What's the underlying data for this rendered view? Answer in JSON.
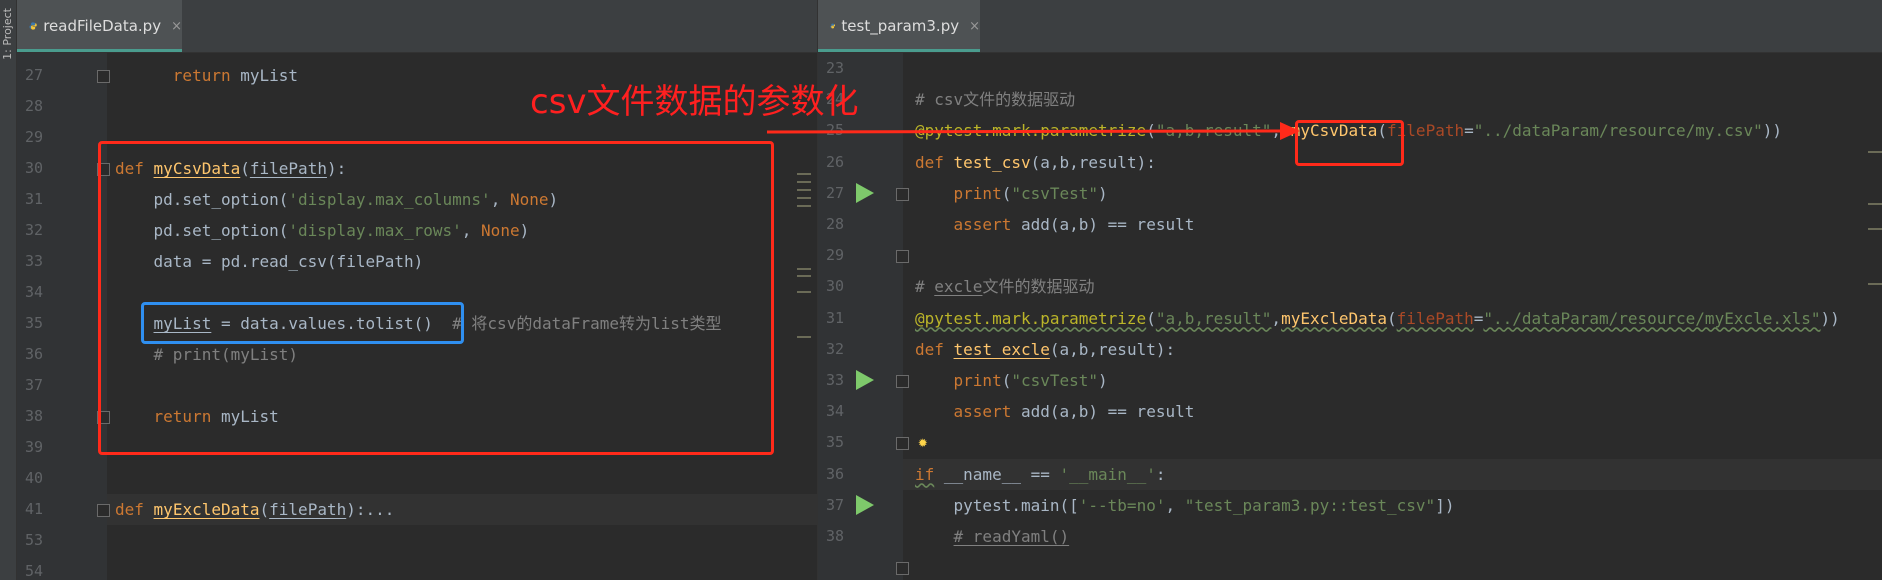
{
  "side_panel": {
    "label": "1: Project"
  },
  "left_editor": {
    "tab": {
      "file_name": "readFileData.py",
      "close": "×"
    },
    "lines": [
      {
        "n": "27",
        "parts": [
          [
            "      ",
            ""
          ],
          [
            "return",
            "kw"
          ],
          [
            " myList",
            ""
          ]
        ]
      },
      {
        "n": "28",
        "parts": []
      },
      {
        "n": "29",
        "parts": []
      },
      {
        "n": "30",
        "parts": [
          [
            "def",
            "kw"
          ],
          [
            " ",
            ""
          ],
          [
            "myCsvData",
            "fn ul"
          ],
          [
            "(",
            ""
          ],
          [
            "filePath",
            "ul"
          ],
          [
            "):",
            ""
          ]
        ]
      },
      {
        "n": "31",
        "parts": [
          [
            "    pd.set_option(",
            ""
          ],
          [
            "'display.max_columns'",
            "str"
          ],
          [
            ", ",
            ""
          ],
          [
            "None",
            "kw"
          ],
          [
            ")",
            ""
          ]
        ]
      },
      {
        "n": "32",
        "parts": [
          [
            "    pd.set_option(",
            ""
          ],
          [
            "'display.max_rows'",
            "str"
          ],
          [
            ", ",
            ""
          ],
          [
            "None",
            "kw"
          ],
          [
            ")",
            ""
          ]
        ]
      },
      {
        "n": "33",
        "parts": [
          [
            "    data = pd.read_csv(filePath)",
            ""
          ]
        ]
      },
      {
        "n": "34",
        "parts": []
      },
      {
        "n": "35",
        "parts": [
          [
            "    ",
            ""
          ],
          [
            "myList",
            "ul"
          ],
          [
            " = data.values.tolist()",
            ""
          ],
          [
            "  # 将csv的dataFrame转为list类型",
            "cm"
          ]
        ]
      },
      {
        "n": "36",
        "parts": [
          [
            "    ",
            ""
          ],
          [
            "# print(myList)",
            "cm"
          ]
        ]
      },
      {
        "n": "37",
        "parts": []
      },
      {
        "n": "38",
        "parts": [
          [
            "    ",
            ""
          ],
          [
            "return",
            "kw"
          ],
          [
            " myList",
            ""
          ]
        ]
      },
      {
        "n": "39",
        "parts": []
      },
      {
        "n": "40",
        "parts": []
      },
      {
        "n": "41",
        "parts": [
          [
            "def",
            "kw"
          ],
          [
            " ",
            ""
          ],
          [
            "myExcleData",
            "fn ul"
          ],
          [
            "(",
            ""
          ],
          [
            "filePath",
            "ul"
          ],
          [
            "):...",
            ""
          ]
        ]
      },
      {
        "n": "53",
        "parts": []
      },
      {
        "n": "54",
        "parts": []
      }
    ]
  },
  "right_editor": {
    "tab": {
      "file_name": "test_param3.py",
      "close": "×"
    },
    "lines": [
      {
        "n": "23",
        "parts": []
      },
      {
        "n": "24",
        "parts": [
          [
            "# csv文件的数据驱动",
            "cm"
          ]
        ]
      },
      {
        "n": "25",
        "parts": [
          [
            "@pytest.mark.parametrize",
            "dec"
          ],
          [
            "(",
            ""
          ],
          [
            "\"a,b,result\"",
            "str"
          ],
          [
            ", ",
            ""
          ],
          [
            "myCsvData",
            "fn"
          ],
          [
            "(",
            ""
          ],
          [
            "filePath",
            "param"
          ],
          [
            "=",
            ""
          ],
          [
            "\"../dataParam/resource/my.csv\"",
            "str"
          ],
          [
            "))",
            ""
          ]
        ]
      },
      {
        "n": "26",
        "parts": [
          [
            "def",
            "kw"
          ],
          [
            " ",
            ""
          ],
          [
            "test_csv",
            "fn"
          ],
          [
            "(a,b,result):",
            ""
          ]
        ]
      },
      {
        "n": "27",
        "parts": [
          [
            "    ",
            ""
          ],
          [
            "print",
            "kw"
          ],
          [
            "(",
            ""
          ],
          [
            "\"csvTest\"",
            "str"
          ],
          [
            ")",
            ""
          ]
        ]
      },
      {
        "n": "28",
        "parts": [
          [
            "    ",
            ""
          ],
          [
            "assert",
            "kw"
          ],
          [
            " add(a,b) == result",
            ""
          ]
        ]
      },
      {
        "n": "29",
        "parts": []
      },
      {
        "n": "30",
        "parts": [
          [
            "# ",
            "cm"
          ],
          [
            "excle",
            "cm ul"
          ],
          [
            "文件的数据驱动",
            "cm"
          ]
        ]
      },
      {
        "n": "31",
        "parts": [
          [
            "@pytest.mark.parametrize",
            "dec wavy"
          ],
          [
            "(",
            ""
          ],
          [
            "\"a,b,result\"",
            "str wavy"
          ],
          [
            ",",
            ""
          ],
          [
            "myExcleData",
            "fn wavy"
          ],
          [
            "(",
            ""
          ],
          [
            "filePath",
            "param wavy"
          ],
          [
            "=",
            ""
          ],
          [
            "\"../dataParam/resource/myExcle.xls\"",
            "str wavy"
          ],
          [
            "))",
            ""
          ]
        ]
      },
      {
        "n": "32",
        "parts": [
          [
            "def",
            "kw"
          ],
          [
            " ",
            ""
          ],
          [
            "test_excle",
            "fn ul"
          ],
          [
            "(a,b,result):",
            ""
          ]
        ]
      },
      {
        "n": "33",
        "parts": [
          [
            "    ",
            ""
          ],
          [
            "print",
            "kw"
          ],
          [
            "(",
            ""
          ],
          [
            "\"csvTest\"",
            "str"
          ],
          [
            ")",
            ""
          ]
        ]
      },
      {
        "n": "34",
        "parts": [
          [
            "    ",
            ""
          ],
          [
            "assert",
            "kw"
          ],
          [
            " add(a,b) == result",
            ""
          ]
        ]
      },
      {
        "n": "35",
        "parts": []
      },
      {
        "n": "36",
        "parts": [
          [
            "if",
            "kw wavy"
          ],
          [
            " __name__ == ",
            ""
          ],
          [
            "'__main__'",
            "str"
          ],
          [
            ":",
            ""
          ]
        ]
      },
      {
        "n": "37",
        "parts": [
          [
            "    pytest.main([",
            ""
          ],
          [
            "'--tb=no'",
            "str"
          ],
          [
            ", ",
            ""
          ],
          [
            "\"test_param3.py::test_csv\"",
            "str"
          ],
          [
            "])",
            ""
          ]
        ]
      },
      {
        "n": "38",
        "parts": [
          [
            "    ",
            ""
          ],
          [
            "# readYaml()",
            "cm ul"
          ]
        ]
      }
    ]
  },
  "annotation": {
    "text": "csv文件数据的参数化"
  },
  "colors": {
    "highlight_red": "#ff2a1a",
    "highlight_blue": "#2f8ff0",
    "run_icon": "#7ec96b"
  }
}
